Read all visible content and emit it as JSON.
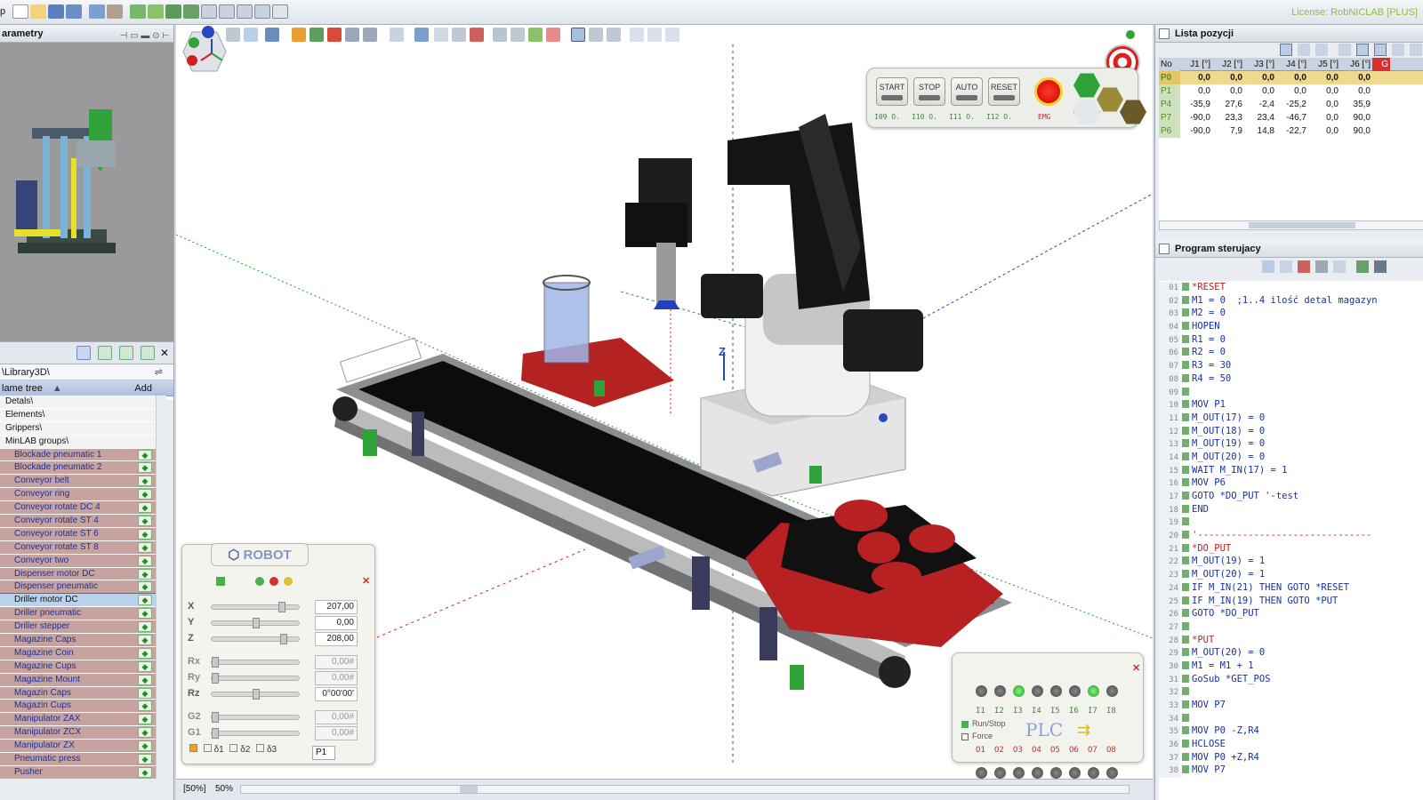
{
  "topbar": {
    "app_initial": "p",
    "license": "License: RobNICLAB [PLUS]"
  },
  "left_panel": {
    "title": "arametry",
    "library_path": "\\Library3D\\",
    "tree_header": "lame tree",
    "tree_add": "Add",
    "folders": [
      "Detals\\",
      "Elements\\",
      "Grippers\\",
      "MinLAB groups\\"
    ],
    "items": [
      "Blockade pneumatic 1",
      "Blockade pneumatic 2",
      "Conveyor belt",
      "Conveyor ring",
      "Conveyor rotate DC 4",
      "Conveyor rotate ST 4",
      "Conveyor rotate ST 6",
      "Conveyor rotate ST 8",
      "Conveyor two",
      "Dispenser motor DC",
      "Dispenser pneumatic",
      "Driller motor DC",
      "Driller pneumatic",
      "Driller stepper",
      "Magazine Caps",
      "Magazine Coin",
      "Magazine Cups",
      "Magazine Mount",
      "Magazin Caps",
      "Magazin Cups",
      "Manipulator ZAX",
      "Manipulator ZCX",
      "Manipulator ZX",
      "Pneumatic press",
      "Pusher"
    ],
    "selected_item": "Driller motor DC"
  },
  "hud": {
    "buttons": [
      "START",
      "STOP",
      "AUTO",
      "RESET"
    ],
    "io": [
      "I09 O.",
      "I10 O.",
      "I11 O.",
      "I12 O.",
      "EMG"
    ]
  },
  "robot_panel": {
    "title": "ROBOT",
    "axes": [
      {
        "label": "X",
        "value": "207,00",
        "level": 0.82
      },
      {
        "label": "Y",
        "value": "0,00",
        "level": 0.5
      },
      {
        "label": "Z",
        "value": "208,00",
        "level": 0.84
      },
      {
        "label": "Rx",
        "value": "0,00#",
        "level": 0.0,
        "dim": true
      },
      {
        "label": "Ry",
        "value": "0,00#",
        "level": 0.0,
        "dim": true
      },
      {
        "label": "Rz",
        "value": "0°00'00'",
        "level": 0.5,
        "dim": false
      },
      {
        "label": "G2",
        "value": "0,00#",
        "level": 0.0,
        "dim": true
      },
      {
        "label": "G1",
        "value": "0,00#",
        "level": 0.0,
        "dim": true
      }
    ],
    "d_labels": [
      "δ1",
      "δ2",
      "δ3"
    ],
    "point": "P1"
  },
  "plc": {
    "title": "PLC",
    "run_stop": "Run/Stop",
    "force": "Force",
    "inputs": [
      "I1",
      "I2",
      "I3",
      "I4",
      "I5",
      "I6",
      "I7",
      "I8"
    ],
    "outputs": [
      "O1",
      "O2",
      "O3",
      "O4",
      "O5",
      "O6",
      "O7",
      "O8"
    ],
    "input_states": [
      0,
      0,
      1,
      0,
      0,
      0,
      1,
      0
    ]
  },
  "viewport": {
    "zoom_a": "[50%]",
    "zoom_b": "50%",
    "axis_label": "Z"
  },
  "positions": {
    "title": "Lista pozycji",
    "columns": [
      "No",
      "J1 [°]",
      "J2 [°]",
      "J3 [°]",
      "J4 [°]",
      "J5 [°]",
      "J6 [°]",
      "G"
    ],
    "rows": [
      [
        "P0",
        "0,0",
        "0,0",
        "0,0",
        "0,0",
        "0,0",
        "0,0"
      ],
      [
        "P1",
        "0,0",
        "0,0",
        "0,0",
        "0,0",
        "0,0",
        "0,0"
      ],
      [
        "P4",
        "-35,9",
        "27,6",
        "-2,4",
        "-25,2",
        "0,0",
        "35,9"
      ],
      [
        "P7",
        "-90,0",
        "23,3",
        "23,4",
        "-46,7",
        "0,0",
        "90,0"
      ],
      [
        "P6",
        "-90,0",
        "7,9",
        "14,8",
        "-22,7",
        "0,0",
        "90,0"
      ]
    ]
  },
  "program": {
    "title": "Program sterujacy",
    "lines": [
      "*RESET",
      "M1 = 0  ;1..4 ilość detal magazyn",
      "M2 = 0",
      "HOPEN",
      "R1 = 0",
      "R2 = 0",
      "R3 = 30",
      "R4 = 50",
      "",
      "MOV P1",
      "M_OUT(17) = 0",
      "M_OUT(18) = 0",
      "M_OUT(19) = 0",
      "M_OUT(20) = 0",
      "WAIT M_IN(17) = 1",
      "MOV P6",
      "GOTO *DO_PUT '-test",
      "END",
      "",
      "'-------------------------------",
      "*DO_PUT",
      "M_OUT(19) = 1",
      "M_OUT(20) = 1",
      "IF M_IN(21) THEN GOTO *RESET",
      "IF M_IN(19) THEN GOTO *PUT",
      "GOTO *DO_PUT",
      "",
      "*PUT",
      "M_OUT(20) = 0",
      "M1 = M1 + 1",
      "GoSub *GET_POS",
      "",
      "MOV P7",
      "",
      "MOV P0 -Z,R4",
      "HCLOSE",
      "MOV P0 +Z,R4",
      "MOV P7"
    ]
  }
}
